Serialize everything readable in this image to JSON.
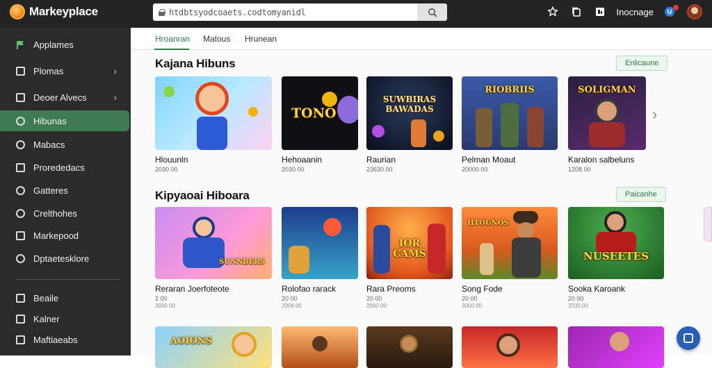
{
  "app": {
    "name": "Markeyplace"
  },
  "urlbar": {
    "url": "htdbtsyodcoaets.codtomyanidl"
  },
  "header": {
    "label": "Inocnage",
    "badge_text": "U"
  },
  "sidebar": {
    "items": [
      {
        "label": "Applames",
        "icon": "flag-icon"
      },
      {
        "label": "Plomas",
        "icon": "grid-icon",
        "has_chevron": true
      },
      {
        "label": "Deoer Alvecs",
        "icon": "box-icon",
        "has_chevron": true
      },
      {
        "label": "Hibunas",
        "icon": "shield-icon",
        "active": true
      },
      {
        "label": "Mabacs",
        "icon": "bag-icon"
      },
      {
        "label": "Prorededacs",
        "icon": "bookmark-icon"
      },
      {
        "label": "Gatteres",
        "icon": "tag-icon"
      },
      {
        "label": "Crelthohes",
        "icon": "gear-icon"
      },
      {
        "label": "Markepood",
        "icon": "card-icon"
      },
      {
        "label": "Dptaetesklore",
        "icon": "clock-icon"
      },
      {
        "label": "Beaile",
        "icon": "doc-icon"
      },
      {
        "label": "Kalner",
        "icon": "list-icon"
      },
      {
        "label": "Maftiaeabs",
        "icon": "chart-icon"
      }
    ]
  },
  "tabs": [
    {
      "label": "Hroanran",
      "active": true
    },
    {
      "label": "Matous"
    },
    {
      "label": "Hrunean"
    }
  ],
  "sections": [
    {
      "title": "Kajana Hibuns",
      "see_all": "Enlicaune",
      "cards": [
        {
          "title": "Hlouunln",
          "meta": "2030 00",
          "meta2": ""
        },
        {
          "title": "Hehoaanin",
          "meta": "2030 00",
          "meta2": ""
        },
        {
          "title": "Raurian",
          "meta": "23630 00",
          "meta2": ""
        },
        {
          "title": "Pelman Moaut",
          "meta": "20000 00",
          "meta2": ""
        },
        {
          "title": "Karalon salbeluns",
          "meta": "1208 00",
          "meta2": ""
        }
      ]
    },
    {
      "title": "Kipyaoai Hiboara",
      "see_all": "Paicanhe",
      "cards": [
        {
          "title": "Reraran Joerfoteote",
          "meta": "2 00",
          "meta2": "3000 00"
        },
        {
          "title": "Rolofao rarack",
          "meta": "20 00",
          "meta2": "2008 00"
        },
        {
          "title": "Rara Preoms",
          "meta": "20 00",
          "meta2": "2000 00"
        },
        {
          "title": "Song Fode",
          "meta": "20 00",
          "meta2": "3000 00"
        },
        {
          "title": "Sooka Karoank",
          "meta": "20 00",
          "meta2": "2030 00"
        }
      ]
    }
  ],
  "thumb_texts": [
    "TONO",
    "SUWBIRAS\nBAWADAS",
    "RIOBRIIS",
    "SOLIGMAN",
    "SUNNBERS",
    "IOR\nCAMS",
    "HTOUNOS",
    "NUSEETES",
    "AOIONS"
  ],
  "colors": {
    "accent": "#3e7b52",
    "topbar": "#242424",
    "sidebar": "#2b2b2b",
    "fab": "#2a5fb8"
  }
}
